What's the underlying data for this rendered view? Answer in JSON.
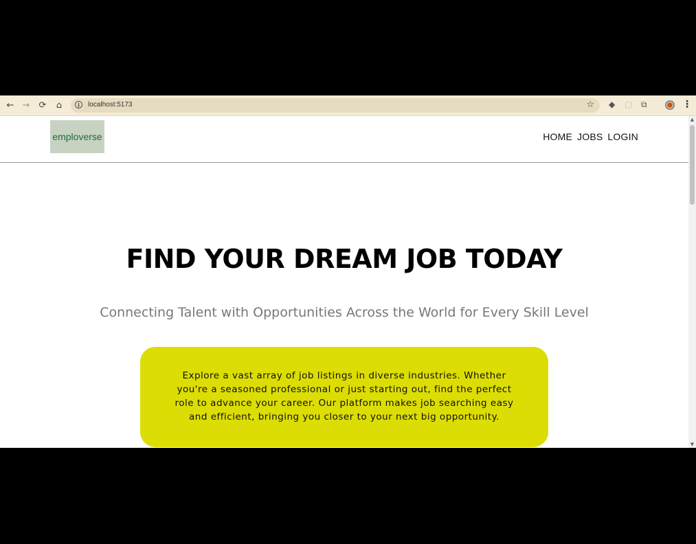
{
  "browser": {
    "address": "localhost:5173",
    "icons": {
      "back": "back-arrow-icon",
      "forward": "forward-arrow-icon",
      "reload": "reload-icon",
      "home": "home-icon",
      "info": "site-info-icon",
      "bookmark": "star-icon",
      "extensions": "puzzle-icon",
      "menu": "more-vert-icon"
    }
  },
  "navbar": {
    "logo_text": "emploverse",
    "links": [
      "HOME",
      "JOBS",
      "LOGIN"
    ]
  },
  "hero": {
    "title": "FIND YOUR DREAM JOB TODAY",
    "subtitle": "Connecting Talent with Opportunities Across the World for Every Skill Level",
    "promo_text": "Explore a vast array of job listings in diverse industries. Whether you're a seasoned professional or just starting out, find the perfect role to advance your career. Our platform makes job searching easy and efficient, bringing you closer to your next big opportunity."
  },
  "colors": {
    "promo_bg": "#dcdd04",
    "logo_bg": "#c8d2c2",
    "logo_text": "#1f6b3a",
    "toolbar_bg": "#f4ecd6"
  }
}
